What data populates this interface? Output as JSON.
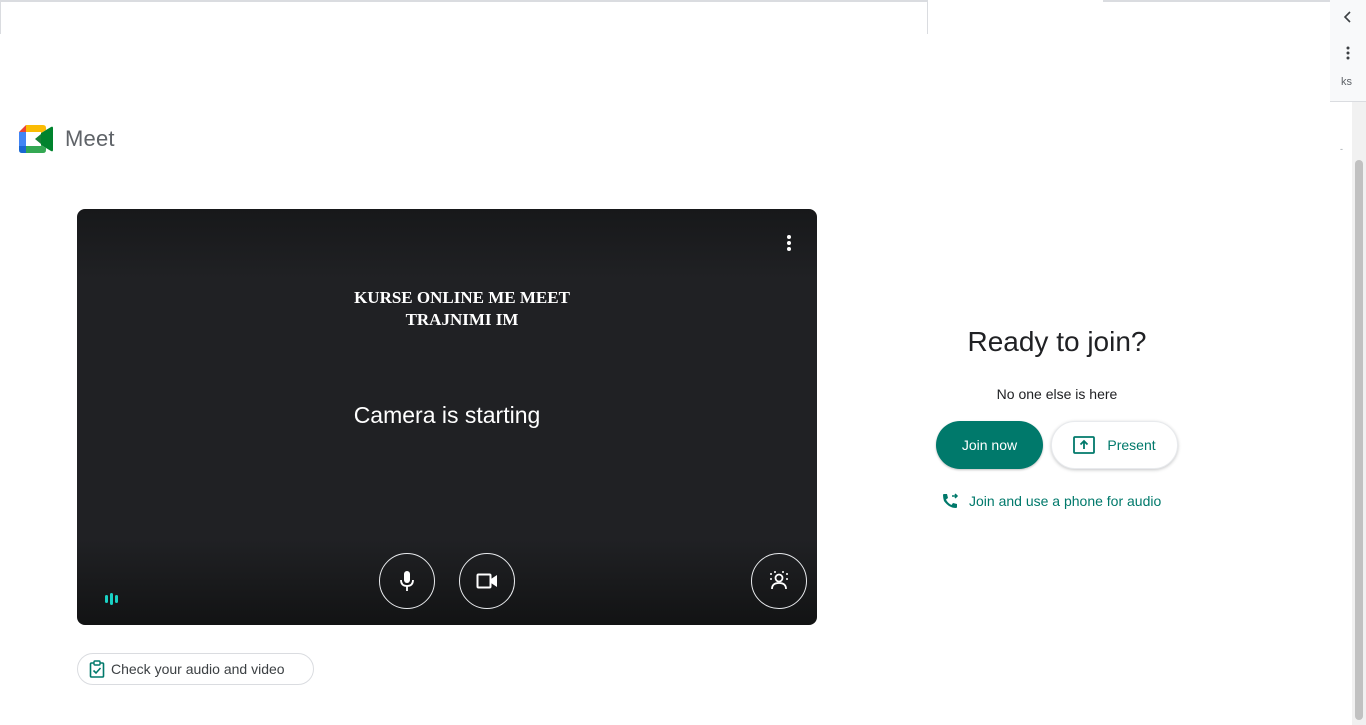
{
  "browser": {
    "side_panel_text": "ks",
    "collapse_icon": "chevron-left-icon",
    "menu_icon": "vertical-dots-icon"
  },
  "header": {
    "app_name": "Meet",
    "logo_icon": "google-meet-logo"
  },
  "preview": {
    "course_title_line1": "KURSE ONLINE ME MEET",
    "course_title_line2": "TRAJNIMI IM",
    "camera_status": "Camera is starting",
    "controls": [
      {
        "name": "microphone",
        "icon": "microphone-icon"
      },
      {
        "name": "camera",
        "icon": "video-camera-icon"
      },
      {
        "name": "background-effects",
        "icon": "background-blur-icon"
      }
    ],
    "more_options_icon": "more-vert-icon"
  },
  "check_audio": {
    "label": "Check your audio and video",
    "icon": "clipboard-check-icon"
  },
  "join": {
    "title": "Ready to join?",
    "subtitle": "No one else is here",
    "join_now_label": "Join now",
    "present_label": "Present",
    "phone_audio_label": "Join and use a phone for audio"
  },
  "colors": {
    "accent": "#00796b",
    "preview_bg": "#202124",
    "audio_indicator": "#1ad1c4"
  }
}
